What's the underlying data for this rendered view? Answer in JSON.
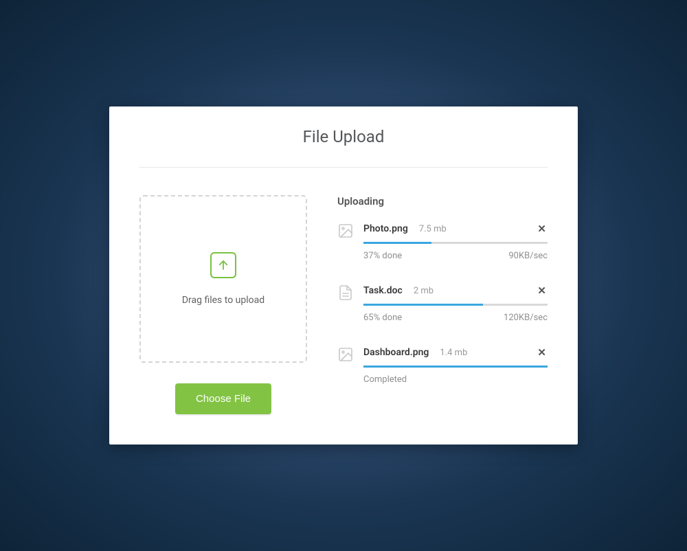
{
  "title": "File Upload",
  "dropzone": {
    "label": "Drag files to upload"
  },
  "choose_button_label": "Choose File",
  "uploading_heading": "Uploading",
  "colors": {
    "accent_green": "#82c344",
    "progress_blue": "#3aa7df"
  },
  "files": [
    {
      "name": "Photo.png",
      "size": "7.5 mb",
      "progress": 37,
      "done_text": "37% done",
      "speed": "90KB/sec",
      "completed": false,
      "icon": "image"
    },
    {
      "name": "Task.doc",
      "size": "2 mb",
      "progress": 65,
      "done_text": "65% done",
      "speed": "120KB/sec",
      "completed": false,
      "icon": "document"
    },
    {
      "name": "Dashboard.png",
      "size": "1.4 mb",
      "progress": 100,
      "done_text": "Completed",
      "speed": "",
      "completed": true,
      "icon": "image"
    }
  ]
}
